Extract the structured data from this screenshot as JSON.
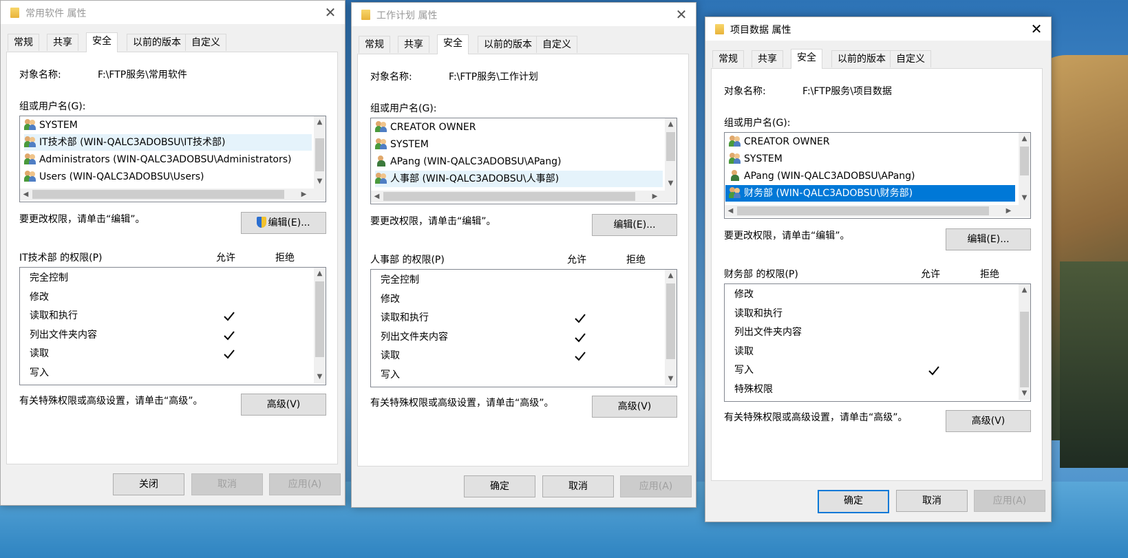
{
  "tabs": [
    "常规",
    "共享",
    "安全",
    "以前的版本",
    "自定义"
  ],
  "labels": {
    "object_name": "对象名称:",
    "groups": "组或用户名(G):",
    "edit_hint": "要更改权限，请单击“编辑”。",
    "allow": "允许",
    "deny": "拒绝",
    "adv_hint": "有关特殊权限或高级设置，请单击“高级”。"
  },
  "buttons": {
    "edit": "编辑(E)...",
    "advanced": "高级(V)",
    "close": "关闭",
    "ok": "确定",
    "cancel": "取消",
    "apply": "应用(A)"
  },
  "icons": [
    "folder-icon",
    "close-icon",
    "user-group-icon",
    "user-icon",
    "shield-icon",
    "checkmark-icon",
    "chevron-up-icon",
    "chevron-down-icon",
    "chevron-left-icon",
    "chevron-right-icon"
  ],
  "dialogs": [
    {
      "title": "常用软件 属性",
      "active": false,
      "object_path": "F:\\FTP服务\\常用软件",
      "users": [
        "SYSTEM",
        "IT技术部 (WIN-QALC3ADOBSU\\IT技术部)",
        "Administrators (WIN-QALC3ADOBSU\\Administrators)",
        "Users (WIN-QALC3ADOBSU\\Users)"
      ],
      "perm_title": "IT技术部 的权限(P)",
      "perms": [
        "完全控制",
        "修改",
        "读取和执行",
        "列出文件夹内容",
        "读取",
        "写入"
      ],
      "allow_checked": [
        false,
        false,
        true,
        true,
        true,
        false
      ]
    },
    {
      "title": "工作计划 属性",
      "active": false,
      "object_path": "F:\\FTP服务\\工作计划",
      "users": [
        "CREATOR OWNER",
        "SYSTEM",
        "APang (WIN-QALC3ADOBSU\\APang)",
        "人事部 (WIN-QALC3ADOBSU\\人事部)"
      ],
      "perm_title": "人事部 的权限(P)",
      "perms": [
        "完全控制",
        "修改",
        "读取和执行",
        "列出文件夹内容",
        "读取",
        "写入"
      ],
      "allow_checked": [
        false,
        false,
        true,
        true,
        true,
        false
      ]
    },
    {
      "title": "项目数据 属性",
      "active": true,
      "object_path": "F:\\FTP服务\\项目数据",
      "users": [
        "CREATOR OWNER",
        "SYSTEM",
        "APang (WIN-QALC3ADOBSU\\APang)",
        "财务部 (WIN-QALC3ADOBSU\\财务部)"
      ],
      "perm_title": "财务部 的权限(P)",
      "perms": [
        "修改",
        "读取和执行",
        "列出文件夹内容",
        "读取",
        "写入",
        "特殊权限"
      ],
      "allow_checked": [
        false,
        false,
        false,
        false,
        true,
        false
      ]
    }
  ]
}
